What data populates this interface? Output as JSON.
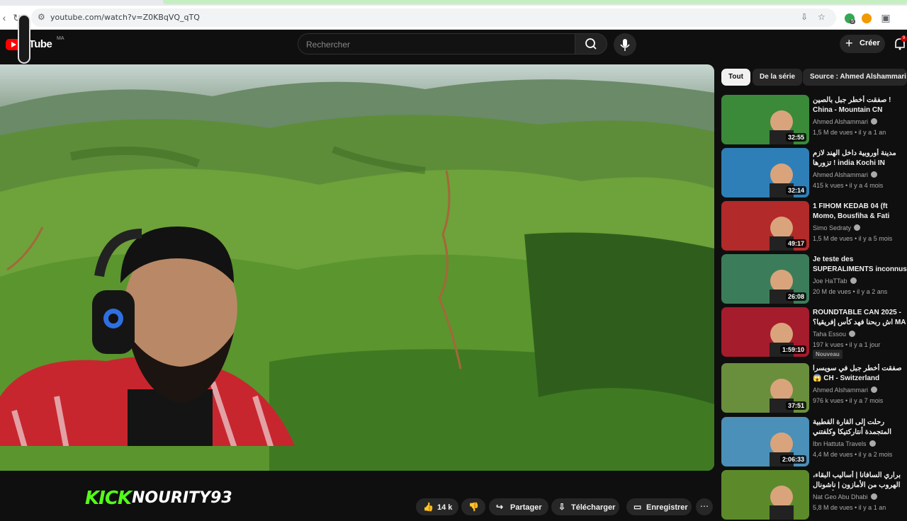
{
  "browser": {
    "url": "youtube.com/watch?v=Z0KBqVQ_qTQ",
    "tab_count": "5"
  },
  "header": {
    "logo_text": "uTube",
    "region": "MA",
    "search_placeholder": "Rechercher",
    "create_label": "Créer",
    "notifications": "9"
  },
  "overlay": {
    "kick": "KICK",
    "streamer": "NOURITY93"
  },
  "actions": {
    "likes": "14 k",
    "share": "Partager",
    "download": "Télécharger",
    "save": "Enregistrer"
  },
  "chips": [
    {
      "label": "Tout",
      "active": true
    },
    {
      "label": "De la série",
      "active": false
    },
    {
      "label": "Source : Ahmed Alshammari",
      "active": false
    }
  ],
  "recommendations": [
    {
      "title": "صفقت أخطر جبل بالصين ! China - Mountain CN",
      "channel": "Ahmed Alshammari",
      "meta": "1,5 M de vues • il y a 1 an",
      "duration": "32:55",
      "thumb_color": "#3a8a3a"
    },
    {
      "title": "مدينة أوروبية داخل الهند لازم تزورها ! india Kochi IN",
      "channel": "Ahmed Alshammari",
      "meta": "415 k vues • il y a 4 mois",
      "duration": "32:14",
      "thumb_color": "#2e7fb8"
    },
    {
      "title": "1 FIHOM KEDAB 04 (ft Momo, Bousfiha & Fati Jamali)",
      "channel": "Simo Sedraty",
      "meta": "1,5 M de vues • il y a 5 mois",
      "duration": "49:17",
      "thumb_color": "#b22a2a"
    },
    {
      "title": "Je teste des SUPERALIMENTS inconnus dans la jungle ...",
      "channel": "Joe HaTTab",
      "meta": "20 M de vues • il y a 2 ans",
      "duration": "26:08",
      "thumb_color": "#3b7d5a"
    },
    {
      "title": "ROUNDTABLE CAN 2025 - اش ربحنا فهد كأس إفريقيا؟ MA",
      "channel": "Taha Essou",
      "meta": "197 k vues • il y a 1 jour",
      "duration": "1:59:10",
      "thumb_color": "#a51c2c"
    },
    {
      "title": "صفقت أخطر جبل في سويسرا 😱 CH - Switzerland Mountains",
      "channel": "Ahmed Alshammari",
      "meta": "976 k vues • il y a 7 mois",
      "duration": "37:51",
      "thumb_color": "#6a8f3c"
    },
    {
      "title": "رحلت إلى القارة القطبية المتجمدة أنتاركتيكا وكلفتني التجربة كاملة AQ",
      "channel": "Ibn Hattuta Travels",
      "meta": "4,4 M de vues • il y a 2 mois",
      "duration": "2:06:33",
      "thumb_color": "#4a90b8"
    },
    {
      "title": "براري السافانا | أساليب البقاء، الهروب من الأمازون | ناشونال جيوغرافيك أبوظبي",
      "channel": "Nat Geo Abu Dhabi",
      "meta": "5,8 M de vues • il y a 1 an",
      "duration": "",
      "thumb_color": "#5c8a2a"
    }
  ],
  "new_badge": "Nouveau"
}
